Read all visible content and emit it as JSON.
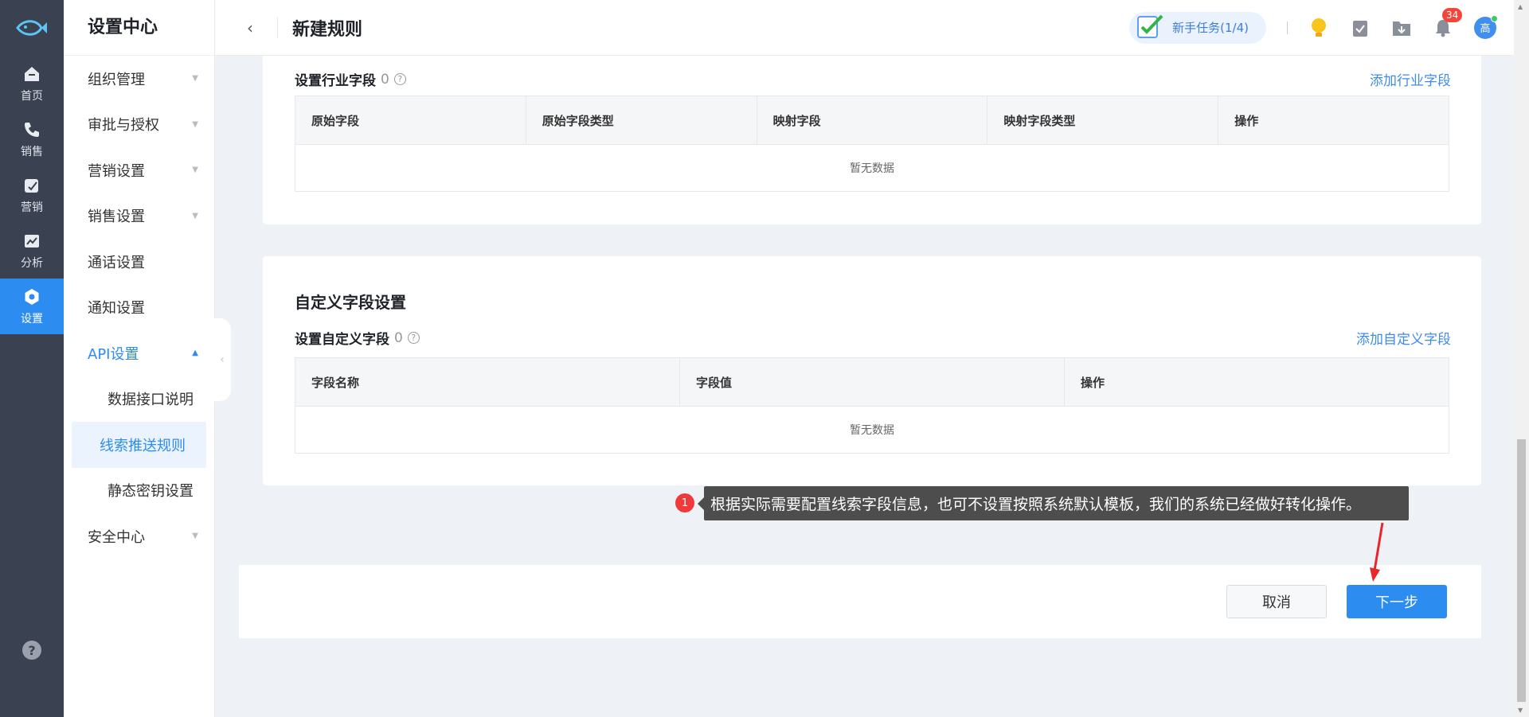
{
  "rail": {
    "items": [
      {
        "label": "首页",
        "icon": "home-icon"
      },
      {
        "label": "销售",
        "icon": "phone-icon"
      },
      {
        "label": "营销",
        "icon": "edit-icon"
      },
      {
        "label": "分析",
        "icon": "chart-icon"
      },
      {
        "label": "设置",
        "icon": "gear-icon",
        "active": true
      }
    ],
    "help": "?"
  },
  "menu": {
    "title": "设置中心",
    "items": [
      {
        "label": "组织管理"
      },
      {
        "label": "审批与授权"
      },
      {
        "label": "营销设置"
      },
      {
        "label": "销售设置"
      },
      {
        "label": "通话设置"
      },
      {
        "label": "通知设置"
      },
      {
        "label": "API设置"
      },
      {
        "label": "安全中心"
      }
    ],
    "api_sub": [
      {
        "label": "数据接口说明"
      },
      {
        "label": "线索推送规则"
      },
      {
        "label": "静态密钥设置"
      }
    ]
  },
  "header": {
    "title": "新建规则",
    "task": "新手任务(1/4)",
    "notif_count": "34",
    "avatar": "高"
  },
  "industry": {
    "label": "设置行业字段",
    "count": "0",
    "add_link": "添加行业字段",
    "columns": [
      "原始字段",
      "原始字段类型",
      "映射字段",
      "映射字段类型",
      "操作"
    ],
    "empty": "暂无数据"
  },
  "custom": {
    "section_title": "自定义字段设置",
    "label": "设置自定义字段",
    "count": "0",
    "add_link": "添加自定义字段",
    "columns": [
      "字段名称",
      "字段值",
      "操作"
    ],
    "empty": "暂无数据"
  },
  "footer": {
    "cancel": "取消",
    "next": "下一步"
  },
  "annotation": {
    "num": "1",
    "text": "根据实际需要配置线索字段信息，也可不设置按照系统默认模板，我们的系统已经做好转化操作。"
  },
  "colors": {
    "accent": "#2d8cf0",
    "rail_bg": "#3a4150",
    "badge": "#f5443a"
  }
}
